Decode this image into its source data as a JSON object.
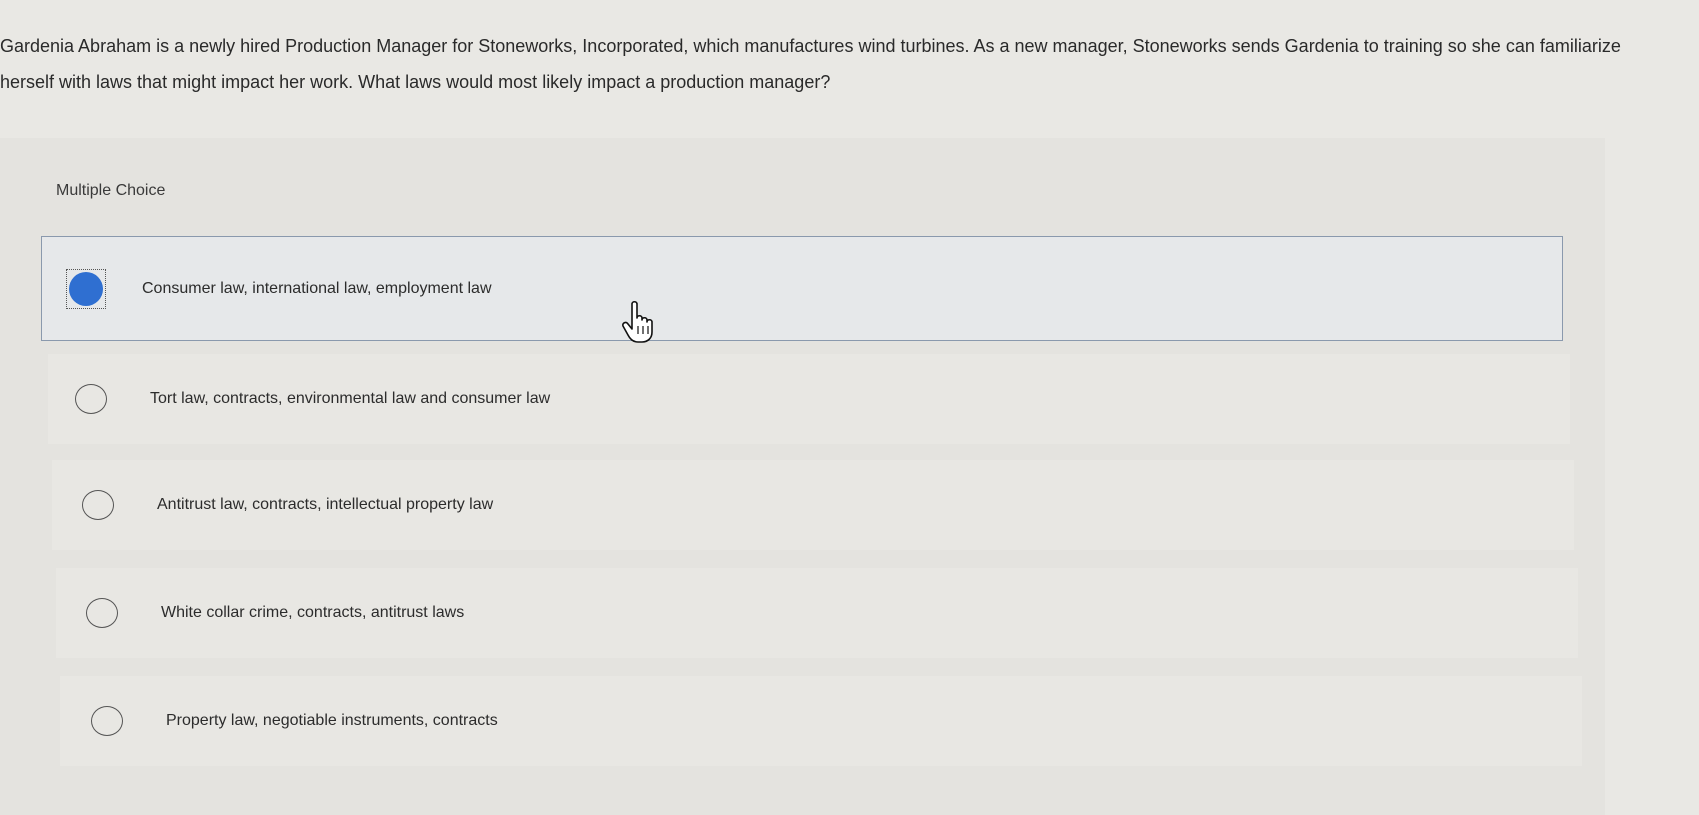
{
  "question": {
    "text": "Gardenia Abraham is a newly hired Production Manager for Stoneworks, Incorporated, which manufactures wind turbines. As a new manager, Stoneworks sends Gardenia to training so she can familiarize herself with laws that might impact her work. What laws would most likely impact a production manager?"
  },
  "choices": {
    "label": "Multiple Choice",
    "selected_index": 0,
    "options": [
      {
        "label": "Consumer law, international law, employment law",
        "selected": true
      },
      {
        "label": "Tort law, contracts, environmental law and consumer law",
        "selected": false
      },
      {
        "label": "Antitrust law, contracts, intellectual property law",
        "selected": false
      },
      {
        "label": "White collar crime, contracts, antitrust laws",
        "selected": false
      },
      {
        "label": "Property law, negotiable instruments, contracts",
        "selected": false
      }
    ]
  },
  "colors": {
    "selected_radio": "#2f6fd1",
    "selected_border": "#8a99ad"
  },
  "icons": {
    "cursor": "hand-pointer-icon"
  }
}
